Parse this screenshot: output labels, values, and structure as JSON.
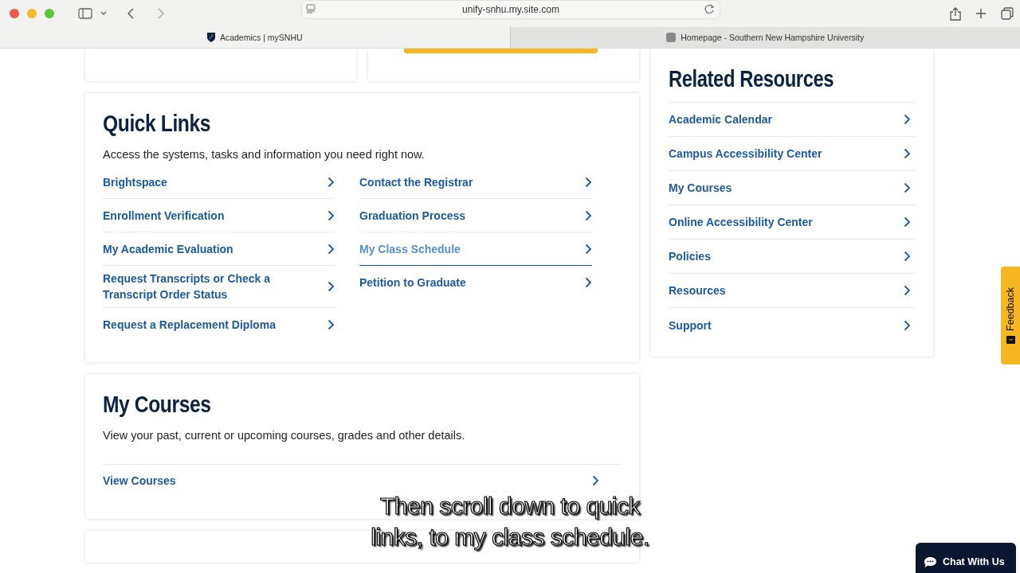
{
  "browser": {
    "address": "unify-snhu.my.site.com",
    "tabs": [
      {
        "title": "Academics | mySNHU",
        "selected": true
      },
      {
        "title": "Homepage - Southern New Hampshire University",
        "selected": false
      }
    ]
  },
  "quick_links": {
    "title": "Quick Links",
    "description": "Access the systems, tasks and information you need right now.",
    "columns": [
      [
        {
          "label": "Brightspace",
          "hovered": false
        },
        {
          "label": "Enrollment Verification",
          "hovered": false
        },
        {
          "label": "My Academic Evaluation",
          "hovered": false
        },
        {
          "label": "Request Transcripts or Check a Transcript Order Status",
          "hovered": false
        },
        {
          "label": "Request a Replacement Diploma",
          "hovered": false
        }
      ],
      [
        {
          "label": "Contact the Registrar",
          "hovered": false
        },
        {
          "label": "Graduation Process",
          "hovered": false
        },
        {
          "label": "My Class Schedule",
          "hovered": true
        },
        {
          "label": "Petition to Graduate",
          "hovered": false
        }
      ]
    ]
  },
  "my_courses": {
    "title": "My Courses",
    "description": "View your past, current or upcoming courses, grades and other details.",
    "link": "View Courses"
  },
  "related_resources": {
    "title": "Related Resources",
    "items": [
      "Academic Calendar",
      "Campus Accessibility Center",
      "My Courses",
      "Online Accessibility Center",
      "Policies",
      "Resources",
      "Support"
    ]
  },
  "feedback_tab": "Feedback",
  "chat_button": "Chat With Us",
  "caption": [
    "Then scroll down to quick",
    "links, to my class schedule."
  ]
}
